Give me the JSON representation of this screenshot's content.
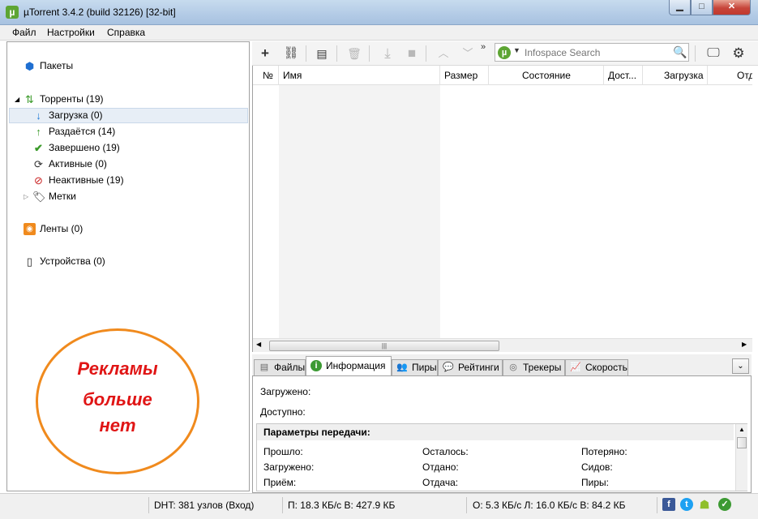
{
  "window": {
    "title": "µTorrent 3.4.2  (build 32126) [32-bit]",
    "logo_letter": "µ",
    "min_glyph": "▁",
    "max_glyph": "□",
    "close_glyph": "✕"
  },
  "menu": [
    "Файл",
    "Настройки",
    "Справка"
  ],
  "sidebar": {
    "items": [
      {
        "label": "Пакеты",
        "icon": "bundle-icon"
      },
      {
        "label": "Торренты (19)",
        "icon": "torrents-icon"
      },
      {
        "label": "Загрузка (0)",
        "icon": "download-arrow-icon",
        "selected": true
      },
      {
        "label": "Раздаётся (14)",
        "icon": "seeding-arrow-icon"
      },
      {
        "label": "Завершено (19)",
        "icon": "checkmark-icon"
      },
      {
        "label": "Активные (0)",
        "icon": "refresh-icon"
      },
      {
        "label": "Неактивные (19)",
        "icon": "inactive-icon"
      },
      {
        "label": "Метки",
        "icon": "tag-icon"
      },
      {
        "label": "Ленты (0)",
        "icon": "rss-icon"
      },
      {
        "label": "Устройства (0)",
        "icon": "device-icon"
      }
    ]
  },
  "ad_overlay": {
    "lines": [
      "Рекламы",
      "больше",
      "нет"
    ],
    "color": "#e01515",
    "border_color": "#f08a1d"
  },
  "toolbar": {
    "search_placeholder": "Infospace Search",
    "search_logo_letter": "µ",
    "more_glyph": "»"
  },
  "columns": [
    "№",
    "Имя",
    "Размер",
    "Состояние",
    "Дост...",
    "Загрузка",
    "Отд"
  ],
  "tabs": [
    {
      "label": "Файлы",
      "icon": "files-icon"
    },
    {
      "label": "Информация",
      "icon": "info-icon",
      "active": true
    },
    {
      "label": "Пиры",
      "icon": "peers-icon"
    },
    {
      "label": "Рейтинги",
      "icon": "ratings-icon"
    },
    {
      "label": "Трекеры",
      "icon": "trackers-icon"
    },
    {
      "label": "Скорость",
      "icon": "speed-icon"
    }
  ],
  "info": {
    "downloaded_label": "Загружено:",
    "available_label": "Доступно:",
    "params_title": "Параметры передачи:",
    "params": [
      [
        "Прошло:",
        "Осталось:",
        "Потеряно:"
      ],
      [
        "Загружено:",
        "Отдано:",
        "Сидов:"
      ],
      [
        "Приём:",
        "Отдача:",
        "Пиры:"
      ]
    ]
  },
  "status": {
    "dht": "DHT: 381 узлов  (Вход)",
    "down": "П: 18.3 КБ/с В: 427.9 КБ",
    "up": "О: 5.3 КБ/с Л: 16.0 КБ/с В: 84.2 КБ"
  }
}
